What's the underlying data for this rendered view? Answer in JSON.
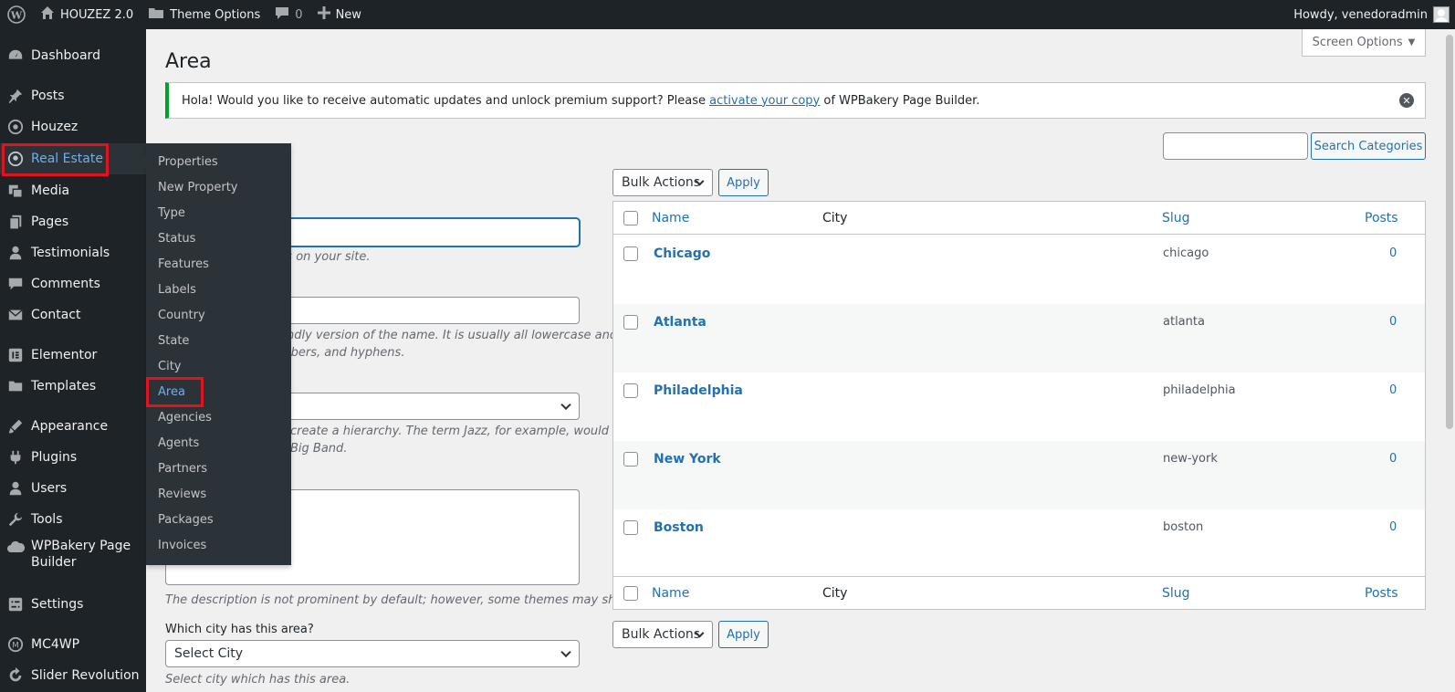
{
  "admin_bar": {
    "site_name": "HOUZEZ 2.0",
    "theme_options": "Theme Options",
    "comments_count": "0",
    "new_label": "New",
    "greeting": "Howdy, venedoradmin"
  },
  "sidebar": {
    "items": [
      {
        "label": "Dashboard",
        "icon": "dashboard-icon"
      },
      {
        "label": "Posts",
        "icon": "pin-icon"
      },
      {
        "label": "Houzez",
        "icon": "circle-icon"
      },
      {
        "label": "Real Estate",
        "icon": "location-icon"
      },
      {
        "label": "Media",
        "icon": "media-icon"
      },
      {
        "label": "Pages",
        "icon": "pages-icon"
      },
      {
        "label": "Testimonials",
        "icon": "person-icon"
      },
      {
        "label": "Comments",
        "icon": "comment-icon"
      },
      {
        "label": "Contact",
        "icon": "mail-icon"
      },
      {
        "label": "Elementor",
        "icon": "elementor-icon"
      },
      {
        "label": "Templates",
        "icon": "folder-icon"
      },
      {
        "label": "Appearance",
        "icon": "brush-icon"
      },
      {
        "label": "Plugins",
        "icon": "plugin-icon"
      },
      {
        "label": "Users",
        "icon": "user-icon"
      },
      {
        "label": "Tools",
        "icon": "wrench-icon"
      },
      {
        "label": "WPBakery Page Builder",
        "icon": "cloud-icon"
      },
      {
        "label": "Settings",
        "icon": "settings-icon"
      },
      {
        "label": "MC4WP",
        "icon": "mc4wp-icon"
      },
      {
        "label": "Slider Revolution",
        "icon": "refresh-icon"
      }
    ]
  },
  "submenu": {
    "items": [
      "Properties",
      "New Property",
      "Type",
      "Status",
      "Features",
      "Labels",
      "Country",
      "State",
      "City",
      "Area",
      "Agencies",
      "Agents",
      "Partners",
      "Reviews",
      "Packages",
      "Invoices"
    ]
  },
  "page": {
    "title": "Area",
    "screen_options": "Screen Options"
  },
  "notice": {
    "text_before": "Hola! Would you like to receive automatic updates and unlock premium support? Please ",
    "link": "activate your copy",
    "text_after": " of WPBakery Page Builder."
  },
  "form": {
    "name_desc_fragment": "ars on your site.",
    "slug_desc_line1": "endly version of the name. It is usually all lowercase and",
    "slug_desc_line2": "mbers, and hyphens.",
    "parent_desc_line1": "create a hierarchy. The term Jazz, for example, would be",
    "parent_desc_line2": "Big Band.",
    "description_note": "The description is not prominent by default; however, some themes may show it.",
    "city_label": "Which city has this area?",
    "city_select": "Select City",
    "city_desc": "Select city which has this area."
  },
  "table": {
    "bulk_actions": "Bulk Actions",
    "apply": "Apply",
    "search_button": "Search Categories",
    "columns": {
      "name": "Name",
      "city": "City",
      "slug": "Slug",
      "posts": "Posts"
    },
    "rows": [
      {
        "name": "Chicago",
        "slug": "chicago",
        "posts": "0"
      },
      {
        "name": "Atlanta",
        "slug": "atlanta",
        "posts": "0"
      },
      {
        "name": "Philadelphia",
        "slug": "philadelphia",
        "posts": "0"
      },
      {
        "name": "New York",
        "slug": "new-york",
        "posts": "0"
      },
      {
        "name": "Boston",
        "slug": "boston",
        "posts": "0"
      }
    ]
  }
}
